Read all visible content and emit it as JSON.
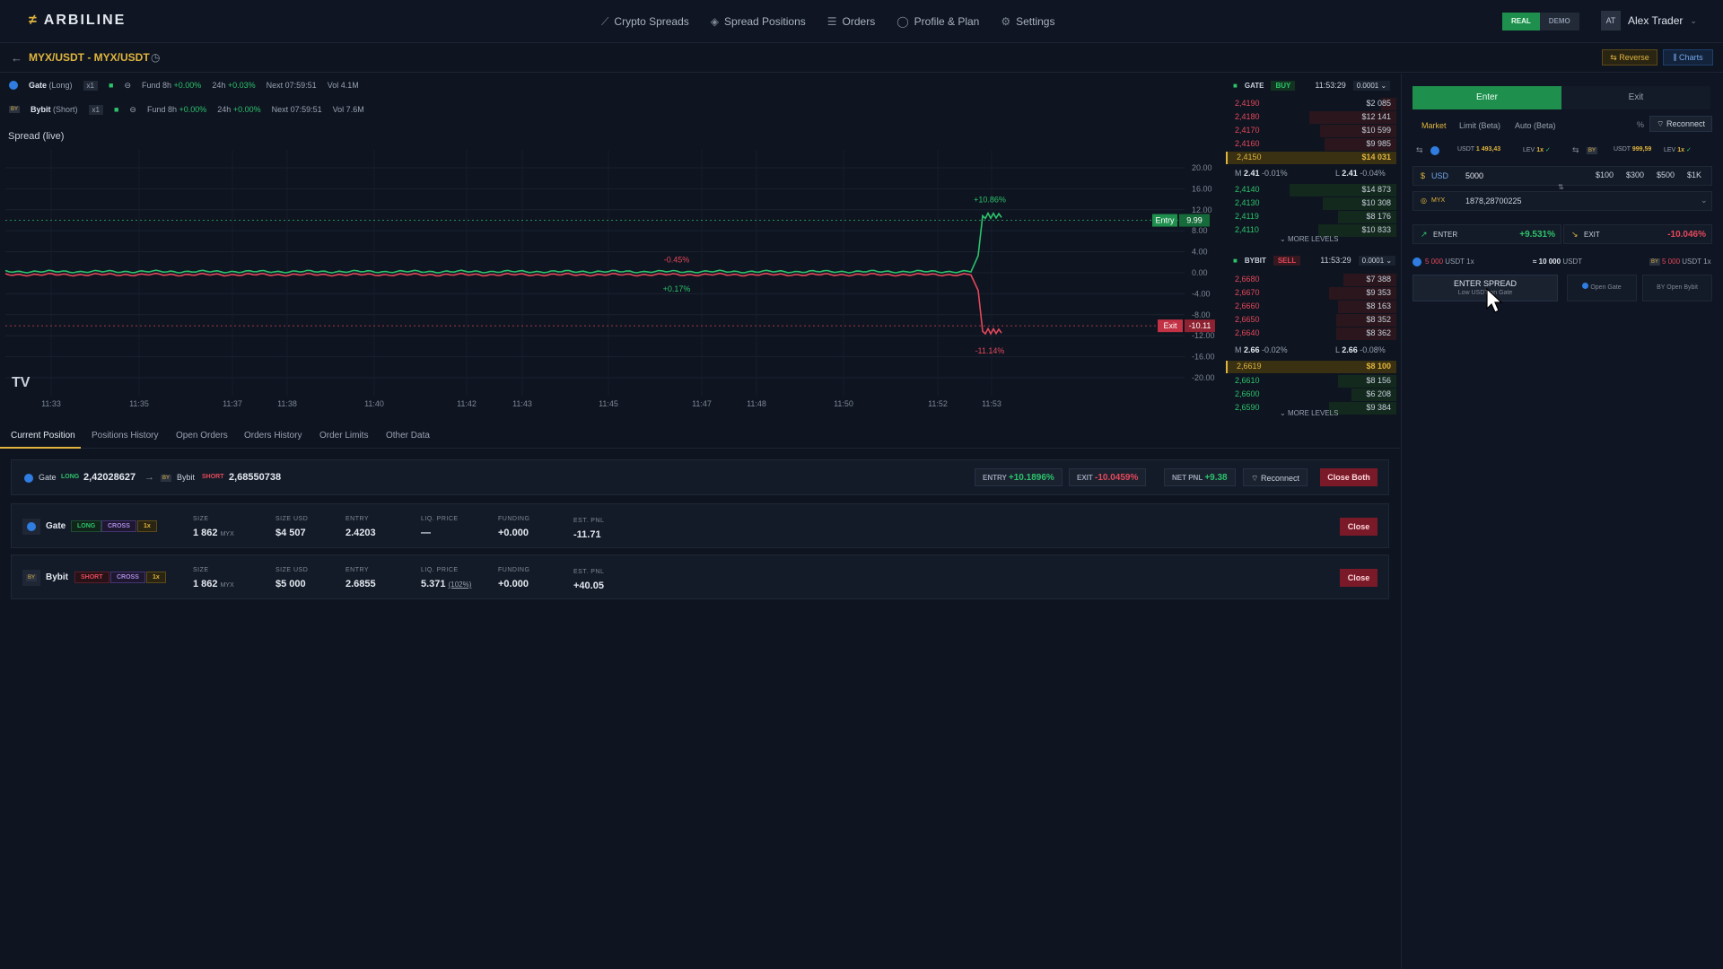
{
  "app": {
    "name": "ARBILINE",
    "logo_glyph": "≠"
  },
  "nav": {
    "links": [
      {
        "icon": "chart-line-icon",
        "label": "Crypto Spreads"
      },
      {
        "icon": "layers-icon",
        "label": "Spread Positions"
      },
      {
        "icon": "orders-icon",
        "label": "Orders"
      },
      {
        "icon": "user-icon",
        "label": "Profile & Plan"
      },
      {
        "icon": "gear-icon",
        "label": "Settings"
      }
    ],
    "mode_real": "REAL",
    "mode_demo": "DEMO",
    "user_initials": "AT",
    "user_name": "Alex Trader"
  },
  "pair": {
    "name": "MYX/USDT - MYX/USDT",
    "reverse_label": "⇆ Reverse",
    "charts_label": "⫼ Charts"
  },
  "legs": [
    {
      "exchange": "Gate",
      "side": "(Long)",
      "lev": "x1",
      "fund_label": "Fund 8h",
      "fund": "+0.00%",
      "d24_label": "24h",
      "d24": "+0.03%",
      "next": "Next 07:59:51",
      "vol": "Vol 4.1M"
    },
    {
      "exchange": "Bybit",
      "side": "(Short)",
      "lev": "x1",
      "fund_label": "Fund 8h",
      "fund": "+0.00%",
      "d24_label": "24h",
      "d24": "+0.00%",
      "next": "Next 07:59:51",
      "vol": "Vol 7.6M"
    }
  ],
  "chart_title": "Spread (live)",
  "chart_data": {
    "type": "line",
    "x": [
      "11:33",
      "11:35",
      "11:37",
      "11:38",
      "11:40",
      "11:42",
      "11:43",
      "11:45",
      "11:47",
      "11:48",
      "11:50",
      "11:52",
      "11:53"
    ],
    "ylim": [
      -20,
      20
    ],
    "yticks": [
      "20.00",
      "16.00",
      "12.00",
      "8.00",
      "4.00",
      "0.00",
      "-4.00",
      "-8.00",
      "-12.00",
      "-16.00",
      "-20.00"
    ],
    "series": [
      {
        "name": "Entry",
        "color": "#2cc36b",
        "values": [
          0.2,
          0.3,
          0.2,
          0.1,
          0.3,
          0.2,
          0.2,
          0.3,
          0.2,
          0.2,
          0.3,
          0.2,
          10.86
        ]
      },
      {
        "name": "Exit",
        "color": "#e4485a",
        "values": [
          -0.4,
          -0.3,
          -0.4,
          -0.3,
          -0.4,
          -0.4,
          -0.45,
          -0.3,
          -0.4,
          -0.4,
          -0.3,
          -0.4,
          -11.14
        ]
      }
    ],
    "entry_line": 9.99,
    "exit_line": -10.11,
    "entry_tag": "Entry",
    "entry_tag_value": "9.99",
    "exit_tag": "Exit",
    "exit_tag_value": "-10.11",
    "annotations": [
      "+10.86%",
      "-0.45%",
      "+0.17%",
      "-11.14%"
    ]
  },
  "orderbook": {
    "gate": {
      "exchange": "GATE",
      "side": "BUY",
      "time": "11:53:29",
      "tick": "0.0001",
      "asks": [
        [
          "2,4190",
          "$2 085"
        ],
        [
          "2,4180",
          "$12 141"
        ],
        [
          "2,4170",
          "$10 599"
        ],
        [
          "2,4160",
          "$9 985"
        ]
      ],
      "best_ask": [
        "2,4150",
        "$14 031"
      ],
      "mid_label": "M",
      "mid": "2.41",
      "mid_chg": "-0.01%",
      "last_label": "L",
      "last": "2.41",
      "last_chg": "-0.04%",
      "bids": [
        [
          "2,4140",
          "$14 873"
        ],
        [
          "2,4130",
          "$10 308"
        ],
        [
          "2,4119",
          "$8 176"
        ],
        [
          "2,4110",
          "$10 833"
        ]
      ],
      "more": "MORE LEVELS"
    },
    "bybit": {
      "exchange": "BYBIT",
      "side": "SELL",
      "time": "11:53:29",
      "tick": "0.0001",
      "asks": [
        [
          "2,6680",
          "$7 388"
        ],
        [
          "2,6670",
          "$9 353"
        ],
        [
          "2,6660",
          "$8 163"
        ],
        [
          "2,6650",
          "$8 352"
        ],
        [
          "2,6640",
          "$8 362"
        ]
      ],
      "mid_label": "M",
      "mid": "2.66",
      "mid_chg": "-0.02%",
      "last_label": "L",
      "last": "2.66",
      "last_chg": "-0.08%",
      "best_bid": [
        "2,6619",
        "$8 100"
      ],
      "bids": [
        [
          "2,6610",
          "$8 156"
        ],
        [
          "2,6600",
          "$6 208"
        ],
        [
          "2,6590",
          "$9 384"
        ]
      ],
      "more": "MORE LEVELS"
    }
  },
  "tabs": [
    "Current Position",
    "Positions History",
    "Open Orders",
    "Orders History",
    "Order Limits",
    "Other Data"
  ],
  "position_summary": {
    "leg_a": "Gate",
    "leg_a_side": "LONG",
    "leg_a_price": "2,42028627",
    "arrow": "→",
    "leg_b": "Bybit",
    "leg_b_side": "SHORT",
    "leg_b_price": "2,68550738",
    "entry_label": "ENTRY",
    "entry_value": "+10.1896%",
    "exit_label": "EXIT",
    "exit_value": "-10.0459%",
    "pnl_label": "NET PNL",
    "pnl_value": "+9.38",
    "reconnect": "Reconnect",
    "close_both": "Close Both"
  },
  "position_rows": [
    {
      "exchange": "Gate",
      "side": "LONG",
      "margin": "CROSS",
      "lev": "1x",
      "size_label": "SIZE",
      "size": "1 862",
      "size_unit": "MYX",
      "sizeusd_label": "SIZE USD",
      "sizeusd": "$4 507",
      "entry_label": "ENTRY",
      "entry": "2.4203",
      "liq_label": "LIQ. PRICE",
      "liq": "—",
      "liq_pct": "",
      "funding_label": "FUNDING",
      "funding": "+0.000",
      "pnl_label": "EST. PNL",
      "pnl": "-11.71",
      "close": "Close"
    },
    {
      "exchange": "Bybit",
      "side": "SHORT",
      "margin": "CROSS",
      "lev": "1x",
      "size_label": "SIZE",
      "size": "1 862",
      "size_unit": "MYX",
      "sizeusd_label": "SIZE USD",
      "sizeusd": "$5 000",
      "entry_label": "ENTRY",
      "entry": "2.6855",
      "liq_label": "LIQ. PRICE",
      "liq": "5.371",
      "liq_pct": "(102%)",
      "funding_label": "FUNDING",
      "funding": "+0.000",
      "pnl_label": "EST. PNL",
      "pnl": "+40.05",
      "close": "Close"
    }
  ],
  "trade": {
    "tab_enter": "Enter",
    "tab_exit": "Exit",
    "modes": [
      "Market",
      "Limit (Beta)",
      "Auto (Beta)"
    ],
    "percent_icon": "%",
    "reconnect": "Reconnect",
    "bal_a_cur": "USDT",
    "bal_a": "1 493,43",
    "lev_label": "LEV",
    "bal_a_lev": "1x",
    "bal_b_cur": "USDT",
    "bal_b": "999,59",
    "bal_b_lev": "1x",
    "usd_label": "USD",
    "usd_value": "5000",
    "presets": [
      "$100",
      "$300",
      "$500",
      "$1K"
    ],
    "coin_label": "MYX",
    "coin_value": "1878,28700225",
    "enter_label": "ENTER",
    "enter_value": "+9.531%",
    "exit_label": "EXIT",
    "exit_value": "-10.046%",
    "alloc_left": "5 000",
    "alloc_left_cur": "USDT 1x",
    "alloc_mid": "≈ 10 000",
    "alloc_mid_cur": "USDT",
    "alloc_right": "5 000",
    "alloc_right_cur": "USDT 1x",
    "enter_spread": "ENTER SPREAD",
    "enter_spread_sub": "Low USDT on Gate",
    "open_gate": "Open Gate",
    "open_bybit": "Open Bybit"
  },
  "colors": {
    "accent": "#e0b53e",
    "up": "#2cc36b",
    "down": "#e4485a",
    "bg": "#0e1420"
  }
}
